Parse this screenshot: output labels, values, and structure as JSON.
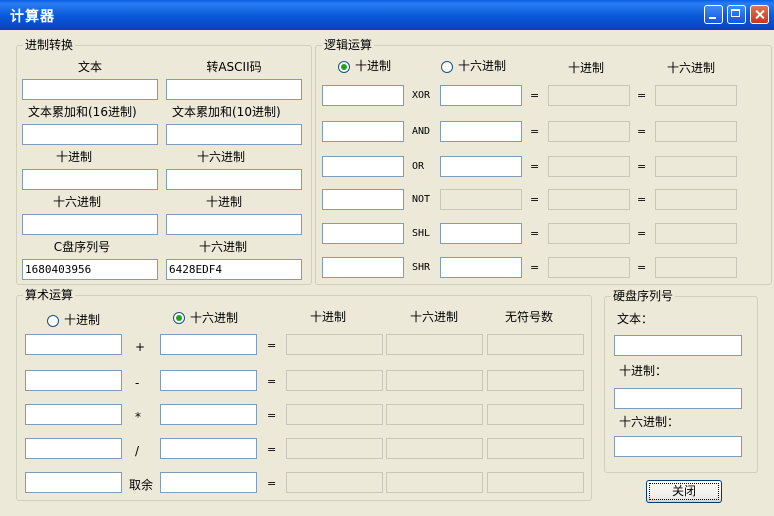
{
  "window": {
    "title": "计算器"
  },
  "base_conversion": {
    "legend": "进制转换",
    "rows": [
      {
        "left_label": "文本",
        "right_label": "转ASCII码",
        "left_value": "",
        "right_value": ""
      },
      {
        "left_label": "文本累加和(16进制)",
        "right_label": "文本累加和(10进制)",
        "left_value": "",
        "right_value": ""
      },
      {
        "left_label": "十进制",
        "right_label": "十六进制",
        "left_value": "",
        "right_value": ""
      },
      {
        "left_label": "十六进制",
        "right_label": "十进制",
        "left_value": "",
        "right_value": ""
      },
      {
        "left_label": "C盘序列号",
        "right_label": "十六进制",
        "left_value": "1680403956",
        "right_value": "6428EDF4"
      }
    ]
  },
  "logic": {
    "legend": "逻辑运算",
    "radio_decimal": "十进制",
    "radio_hex": "十六进制",
    "selected": "decimal",
    "col_decimal": "十进制",
    "col_hex": "十六进制",
    "eq": "=",
    "ops": [
      "XOR",
      "AND",
      "OR",
      "NOT",
      "SHL",
      "SHR"
    ]
  },
  "arith": {
    "legend": "算术运算",
    "radio_decimal": "十进制",
    "radio_hex": "十六进制",
    "selected": "hex",
    "col_decimal": "十进制",
    "col_hex": "十六进制",
    "col_unsigned": "无符号数",
    "eq": "=",
    "ops": [
      "+",
      "-",
      "*",
      "/",
      "取余"
    ]
  },
  "disk": {
    "legend": "硬盘序列号",
    "text_label": "文本：",
    "decimal_label": "十进制：",
    "hex_label": "十六进制：",
    "text_value": "",
    "decimal_value": "",
    "hex_value": ""
  },
  "buttons": {
    "close": "关闭"
  }
}
